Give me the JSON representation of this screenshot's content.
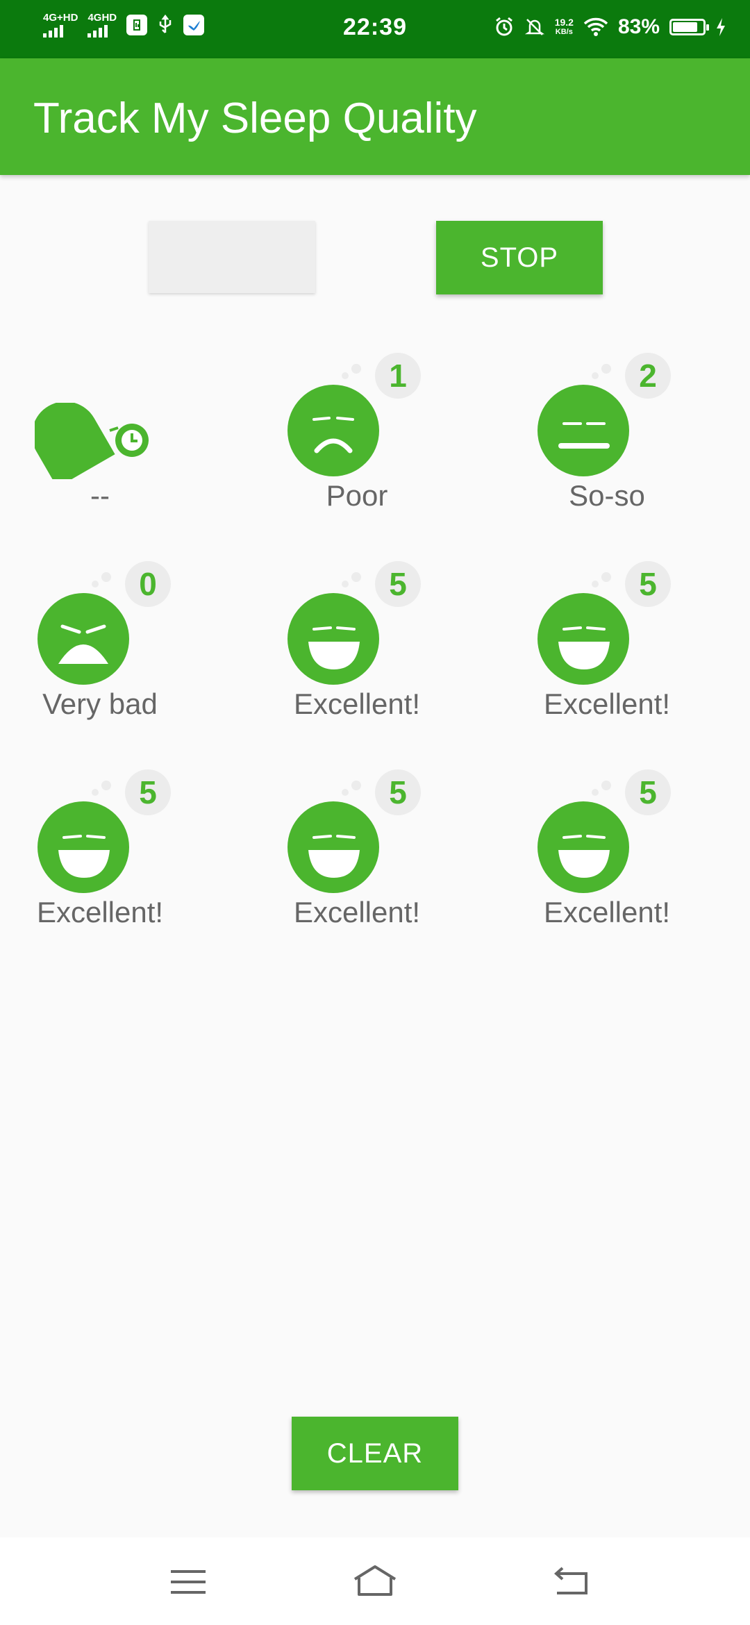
{
  "status_bar": {
    "signal1": "4G+HD",
    "signal2": "4GHD",
    "time": "22:39",
    "net_speed_value": "19.2",
    "net_speed_unit": "KB/s",
    "battery_percent": "83%",
    "battery_level": 0.83
  },
  "app_bar": {
    "title": "Track My Sleep Quality"
  },
  "controls": {
    "start_label": "",
    "stop_label": "STOP",
    "clear_label": "CLEAR"
  },
  "nights": [
    {
      "type": "in-progress",
      "quality": "",
      "label": "--"
    },
    {
      "type": "face",
      "face": "poor",
      "quality": "1",
      "label": "Poor"
    },
    {
      "type": "face",
      "face": "so-so",
      "quality": "2",
      "label": "So-so"
    },
    {
      "type": "face",
      "face": "very-bad",
      "quality": "0",
      "label": "Very bad"
    },
    {
      "type": "face",
      "face": "excellent",
      "quality": "5",
      "label": "Excellent!"
    },
    {
      "type": "face",
      "face": "excellent",
      "quality": "5",
      "label": "Excellent!"
    },
    {
      "type": "face",
      "face": "excellent",
      "quality": "5",
      "label": "Excellent!"
    },
    {
      "type": "face",
      "face": "excellent",
      "quality": "5",
      "label": "Excellent!"
    },
    {
      "type": "face",
      "face": "excellent",
      "quality": "5",
      "label": "Excellent!"
    }
  ],
  "nav": {
    "icons": [
      "menu-icon",
      "home-icon",
      "back-icon"
    ]
  },
  "colors": {
    "primary": "#4bb52e",
    "status_bar": "#0b7a0d",
    "badge_bg": "#ececec",
    "label_text": "#666666"
  }
}
